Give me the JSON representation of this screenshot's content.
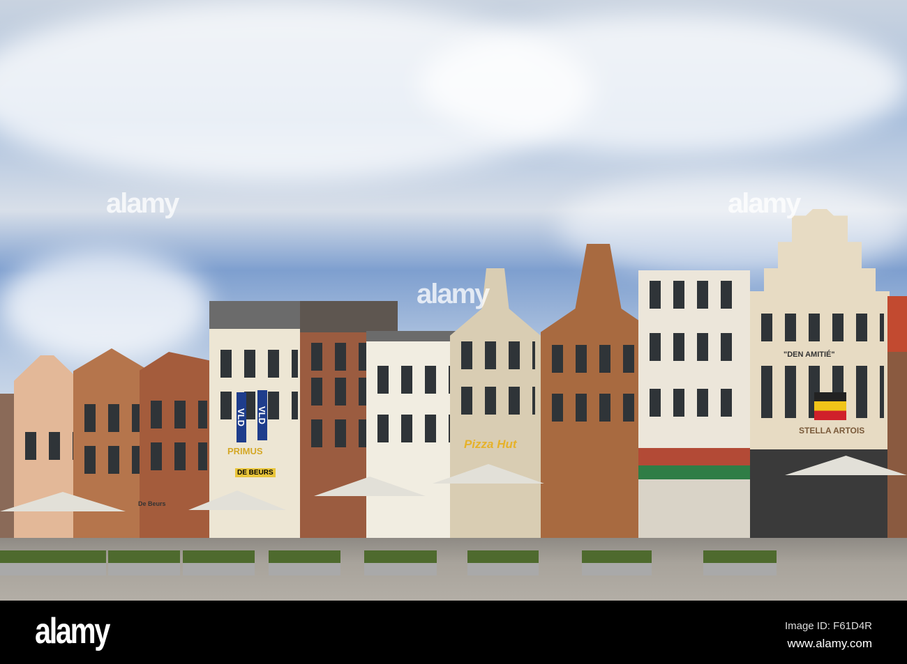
{
  "watermark": {
    "text": "alamy"
  },
  "signs": {
    "vld_1": "VLD",
    "vld_2": "VLD",
    "primus": "PRIMUS",
    "de_beurs": "DE BEURS",
    "de_beurs_awning": "De Beurs",
    "pizza_hut": "Pizza Hut",
    "den_amitie": "\"DEN AMITIÉ\"",
    "stella": "STELLA ARTOIS"
  },
  "footer": {
    "logo": "alamy",
    "image_id": "Image ID: F61D4R",
    "url": "www.alamy.com"
  }
}
